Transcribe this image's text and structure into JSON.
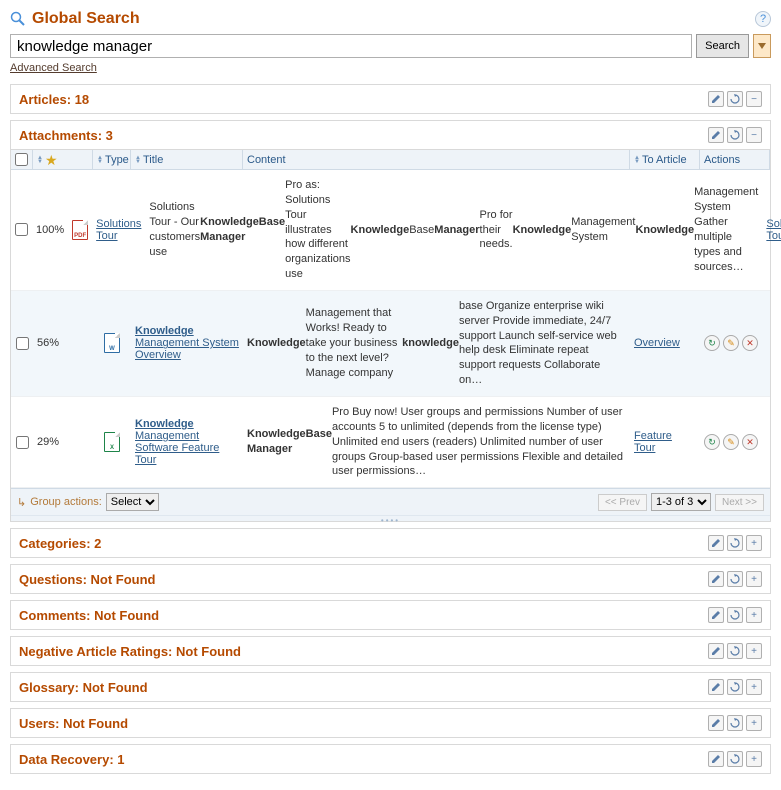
{
  "header": {
    "title": "Global Search"
  },
  "search": {
    "value": "knowledge manager",
    "button": "Search",
    "advanced": "Advanced Search"
  },
  "sections": {
    "articles": "Articles: 18",
    "attachments": "Attachments: 3",
    "categories": "Categories: 2",
    "questions": "Questions: Not Found",
    "comments": "Comments: Not Found",
    "negative": "Negative Article Ratings: Not Found",
    "glossary": "Glossary: Not Found",
    "users": "Users: Not Found",
    "recovery": "Data Recovery: 1"
  },
  "grid": {
    "headers": {
      "type": "Type",
      "title": "Title",
      "content": "Content",
      "to_article": "To Article",
      "actions": "Actions"
    },
    "rows": [
      {
        "relevance": "100%",
        "file_type": "PDF",
        "title": "Solutions Tour",
        "content_html": "Solutions Tour - Our customers use <b>KnowledgeBase Manager</b> Pro as: Solutions Tour illustrates how different organizations use <b>Knowledge</b> Base <b>Manager</b> Pro for their needs. <b>Knowledge</b> Management System <b>Knowledge</b> Management System Gather multiple types and sources…",
        "to_article": "Solutions Tour"
      },
      {
        "relevance": "56%",
        "file_type": "DOC",
        "title_html": "<b>Knowledge</b> Management System Overview",
        "content_html": "<b>Knowledge</b> Management that Works! Ready to take your business to the next level? Manage company <b>knowledge</b> base Organize enterprise wiki server Provide immediate, 24/7 support Launch self-service web help desk Eliminate repeat support requests Collaborate on…",
        "to_article": "Overview"
      },
      {
        "relevance": "29%",
        "file_type": "XLS",
        "title_html": "<b>Knowledge</b> Management Software Feature Tour",
        "content_html": "<b>KnowledgeBase Manager</b> Pro Buy now! User groups and permissions Number of user accounts 5 to unlimited (depends from the license type) Unlimited end users (readers) Unlimited number of user groups Group-based user permissions Flexible and detailed user permissions…",
        "to_article": "Feature Tour"
      }
    ],
    "footer": {
      "group_actions": "Group actions:",
      "select_label": "Select",
      "prev": "<< Prev",
      "page_range": "1-3 of 3",
      "next": "Next >>"
    }
  }
}
